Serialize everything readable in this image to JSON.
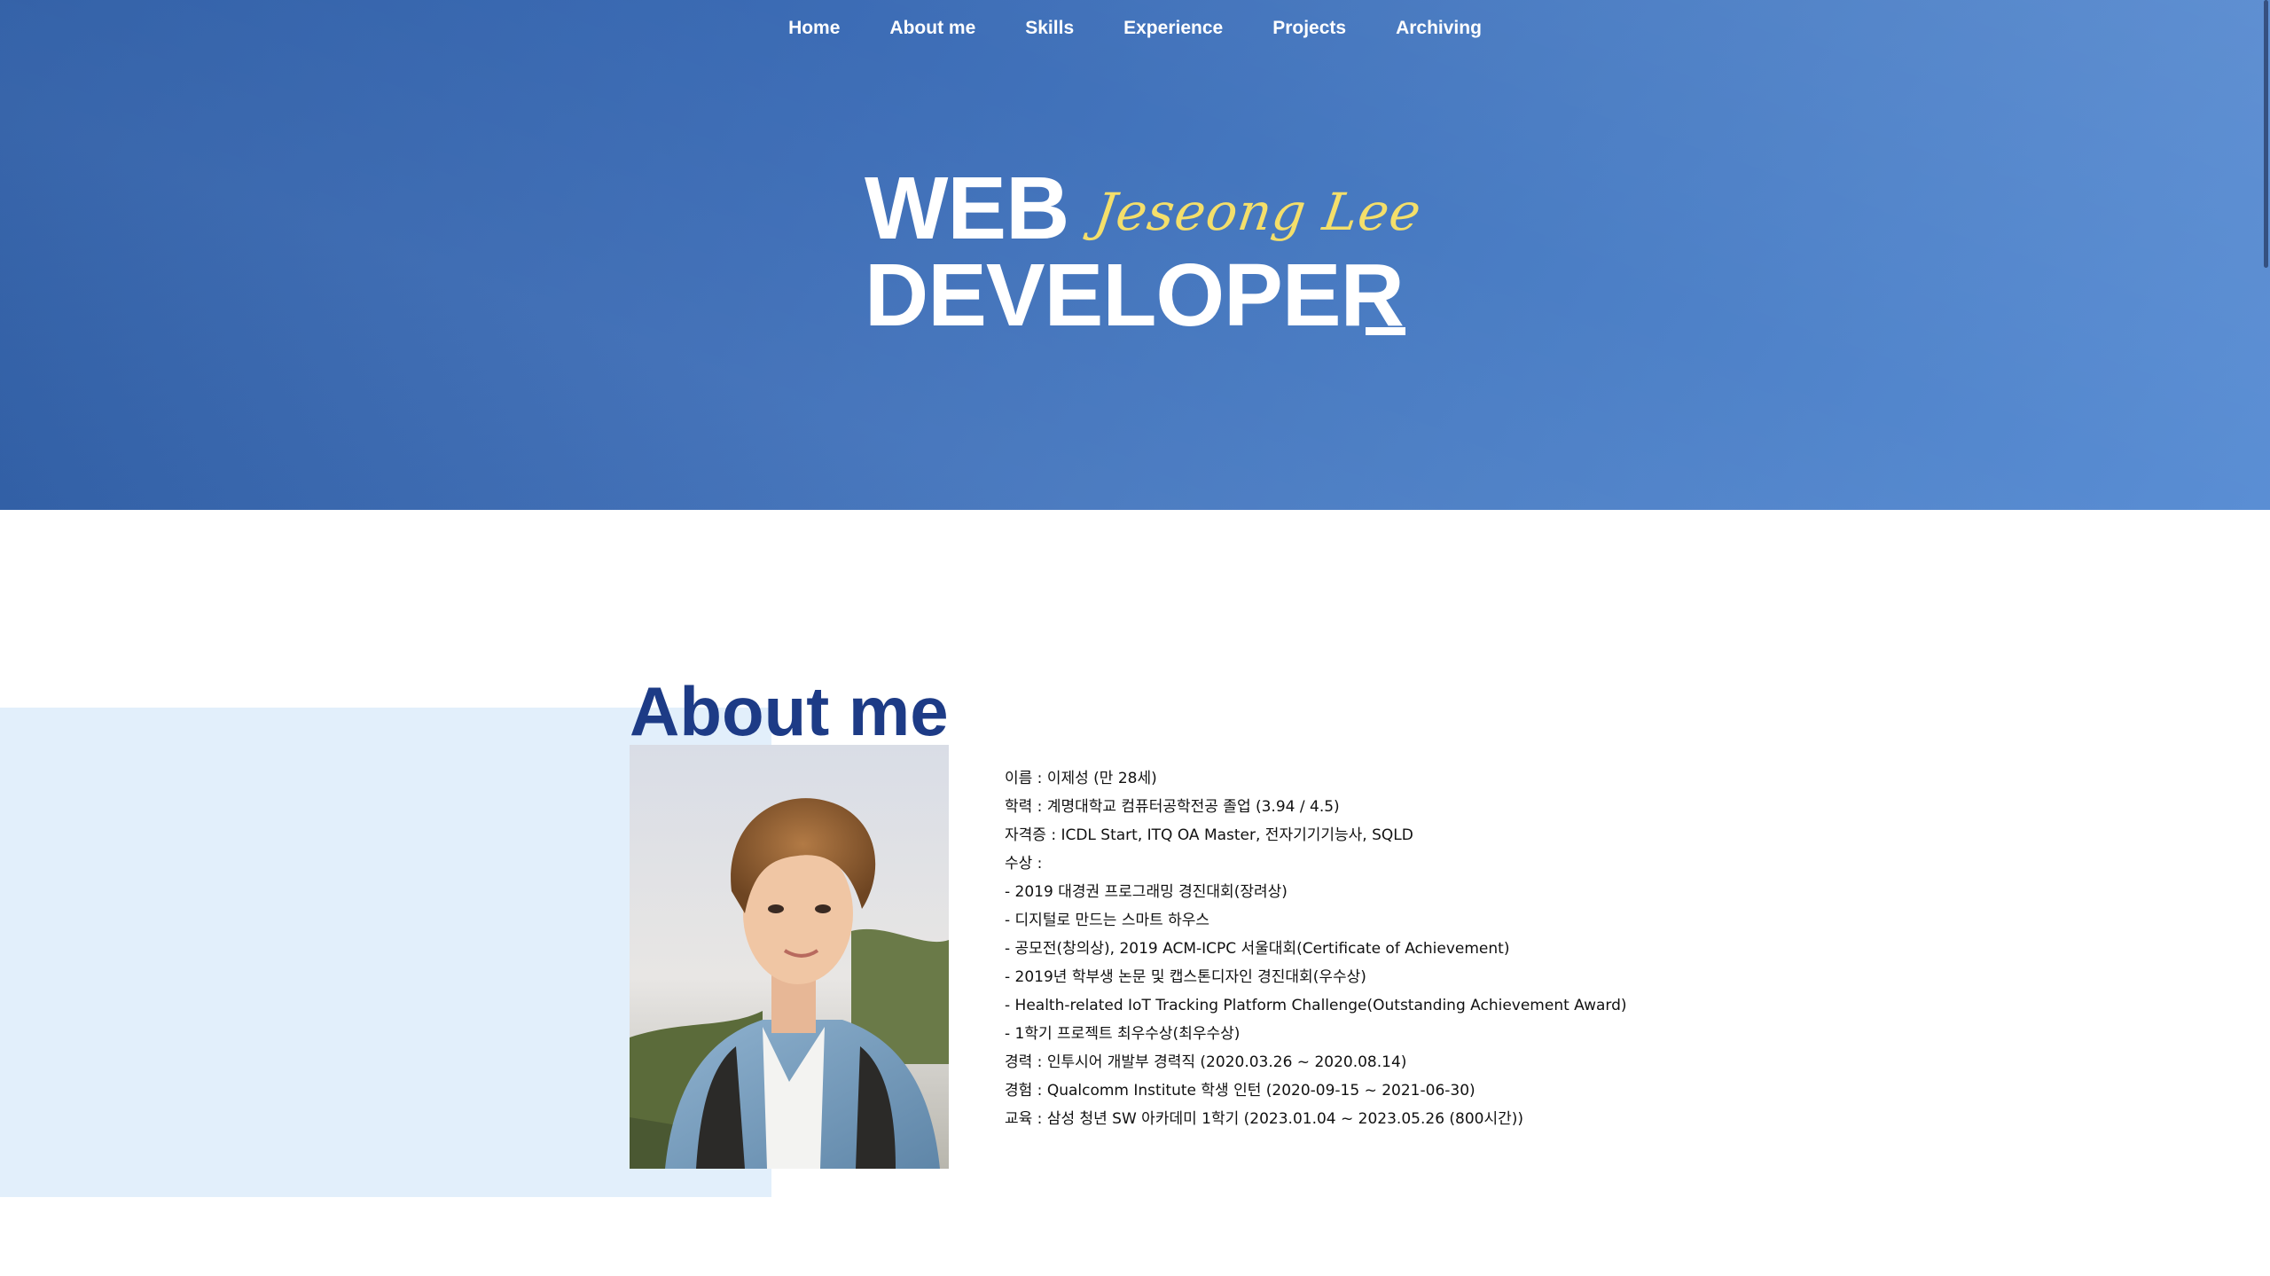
{
  "nav": {
    "items": [
      {
        "label": "Home"
      },
      {
        "label": "About me"
      },
      {
        "label": "Skills"
      },
      {
        "label": "Experience"
      },
      {
        "label": "Projects"
      },
      {
        "label": "Archiving"
      }
    ]
  },
  "hero": {
    "title_line1": "WEB",
    "title_line2": "DEVELOPER",
    "signature": "Jeseong Lee"
  },
  "about": {
    "heading": "About me",
    "lines": [
      "이름 : 이제성 (만 28세)",
      "학력 : 계명대학교 컴퓨터공학전공 졸업 (3.94 / 4.5)",
      "자격증 : ICDL Start, ITQ OA Master, 전자기기기능사, SQLD",
      "수상 :",
      "- 2019 대경권 프로그래밍 경진대회(장려상)",
      "- 디지털로 만드는 스마트 하우스",
      "- 공모전(창의상), 2019 ACM-ICPC 서울대회(Certificate of Achievement)",
      "- 2019년 학부생 논문 및 캡스톤디자인 경진대회(우수상)",
      "- Health-related IoT Tracking Platform Challenge(Outstanding Achievement Award)",
      "- 1학기 프로젝트 최우수상(최우수상)",
      "경력 : 인투시어 개발부 경력직 (2020.03.26 ~ 2020.08.14)",
      "경험 : Qualcomm Institute 학생 인턴 (2020-09-15 ~ 2021-06-30)",
      "교육 : 삼성 청년 SW 아카데미 1학기 (2023.01.04 ~ 2023.05.26 (800시간))"
    ]
  },
  "colors": {
    "hero_blue": "#3d6db6",
    "heading_navy": "#1d3b86",
    "signature_yellow": "#f4df6a",
    "about_panel": "#e2effb"
  }
}
